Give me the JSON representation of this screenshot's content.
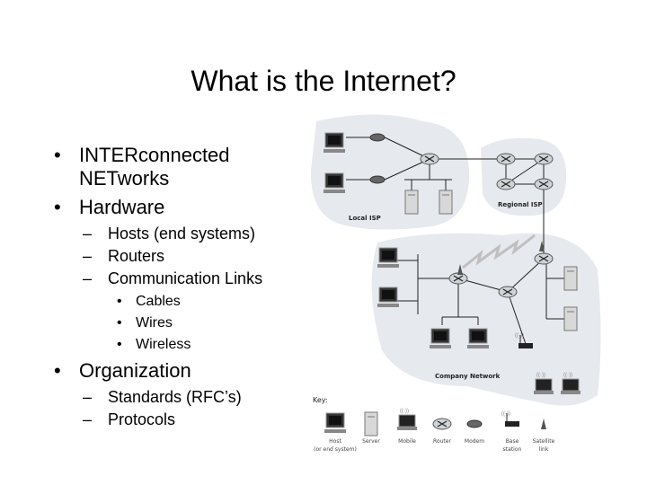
{
  "slide": {
    "title": "What is the Internet?",
    "bullets": [
      {
        "text": "INTERconnected",
        "continuation": "NETworks"
      },
      {
        "text": "Hardware"
      },
      {
        "text": "Organization"
      }
    ],
    "hardware_items": [
      "Hosts (end systems)",
      "Routers",
      "Communication Links"
    ],
    "link_items": [
      "Cables",
      "Wires",
      "Wireless"
    ],
    "organization_items": [
      "Standards (RFC’s)",
      "Protocols"
    ],
    "bullet_glyph": "•",
    "dash_glyph": "–"
  },
  "diagram": {
    "regions": {
      "local": "Local ISP",
      "regional": "Regional ISP",
      "company": "Company Network"
    },
    "key_title": "Key:",
    "key": [
      {
        "icon": "host-icon",
        "label": "Host",
        "label2": "(or end system)"
      },
      {
        "icon": "server-icon",
        "label": "Server"
      },
      {
        "icon": "mobile-icon",
        "label": "Mobile"
      },
      {
        "icon": "router-icon",
        "label": "Router"
      },
      {
        "icon": "modem-icon",
        "label": "Modem"
      },
      {
        "icon": "base-station-icon",
        "label": "Base",
        "label2": "station"
      },
      {
        "icon": "satellite-link-icon",
        "label": "Satellite",
        "label2": "link"
      }
    ],
    "colors": {
      "region": "#e6e9ee",
      "link": "#222222",
      "wireless": "#bfbfbf"
    }
  }
}
